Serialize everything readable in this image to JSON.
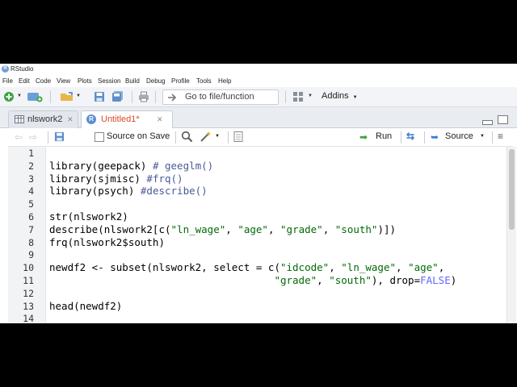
{
  "app": {
    "title": "RStudio",
    "logo_letter": "R"
  },
  "menu": [
    "File",
    "Edit",
    "Code",
    "View",
    "Plots",
    "Session",
    "Build",
    "Debug",
    "Profile",
    "Tools",
    "Help"
  ],
  "toolbar": {
    "goto_placeholder": "Go to file/function",
    "addins_label": "Addins"
  },
  "tabs": [
    {
      "label": "nlswork2",
      "active": false
    },
    {
      "label": "Untitled1*",
      "active": true
    }
  ],
  "editor_toolbar": {
    "source_on_save": "Source on Save",
    "run": "Run",
    "source": "Source"
  },
  "code": {
    "line_numbers": [
      "1",
      "2",
      "3",
      "4",
      "5",
      "6",
      "7",
      "8",
      "9",
      "10",
      "11",
      "12",
      "13",
      "14"
    ],
    "lines": [
      [],
      [
        {
          "t": "library(geepack) "
        },
        {
          "t": "# geeglm()",
          "c": "cm"
        }
      ],
      [
        {
          "t": "library(sjmisc) "
        },
        {
          "t": "#frq()",
          "c": "cm"
        }
      ],
      [
        {
          "t": "library(psych) "
        },
        {
          "t": "#describe()",
          "c": "cm"
        }
      ],
      [],
      [
        {
          "t": "str(nlswork2)"
        }
      ],
      [
        {
          "t": "describe(nlswork2[c("
        },
        {
          "t": "\"ln_wage\"",
          "c": "st"
        },
        {
          "t": ", "
        },
        {
          "t": "\"age\"",
          "c": "st"
        },
        {
          "t": ", "
        },
        {
          "t": "\"grade\"",
          "c": "st"
        },
        {
          "t": ", "
        },
        {
          "t": "\"south\"",
          "c": "st"
        },
        {
          "t": ")])"
        }
      ],
      [
        {
          "t": "frq(nlswork2$south)"
        }
      ],
      [],
      [
        {
          "t": "newdf2 <- subset(nlswork2, select = c("
        },
        {
          "t": "\"idcode\"",
          "c": "st"
        },
        {
          "t": ", "
        },
        {
          "t": "\"ln_wage\"",
          "c": "st"
        },
        {
          "t": ", "
        },
        {
          "t": "\"age\"",
          "c": "st"
        },
        {
          "t": ","
        }
      ],
      [
        {
          "t": "                                     "
        },
        {
          "t": "\"grade\"",
          "c": "st"
        },
        {
          "t": ", "
        },
        {
          "t": "\"south\"",
          "c": "st"
        },
        {
          "t": "), drop="
        },
        {
          "t": "FALSE",
          "c": "kw"
        },
        {
          "t": ")"
        }
      ],
      [],
      [
        {
          "t": "head(newdf2)"
        }
      ],
      []
    ]
  },
  "colors": {
    "accent_blue": "#4a7fc1",
    "active_tab_text": "#d94c2b",
    "string": "#036a07",
    "comment": "#4a5a9b",
    "keyword": "#6666ff"
  }
}
